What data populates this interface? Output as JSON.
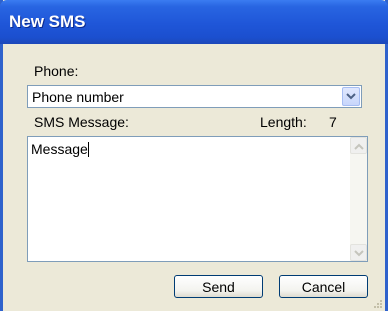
{
  "window": {
    "title": "New SMS"
  },
  "form": {
    "phone_label": "Phone:",
    "phone_value": "Phone number",
    "sms_label": "SMS Message:",
    "length_label": "Length:",
    "length_value": "7",
    "message_value": "Message"
  },
  "buttons": {
    "send": "Send",
    "cancel": "Cancel"
  },
  "icons": {
    "combo_dropdown": "chevron-down-icon",
    "scroll_up": "arrow-up-icon",
    "scroll_down": "arrow-down-icon",
    "resize_grip": "resize-grip-icon"
  },
  "colors": {
    "titlebar": "#1f56d8",
    "window_bg": "#ece9d8",
    "button_border": "#003c74"
  }
}
